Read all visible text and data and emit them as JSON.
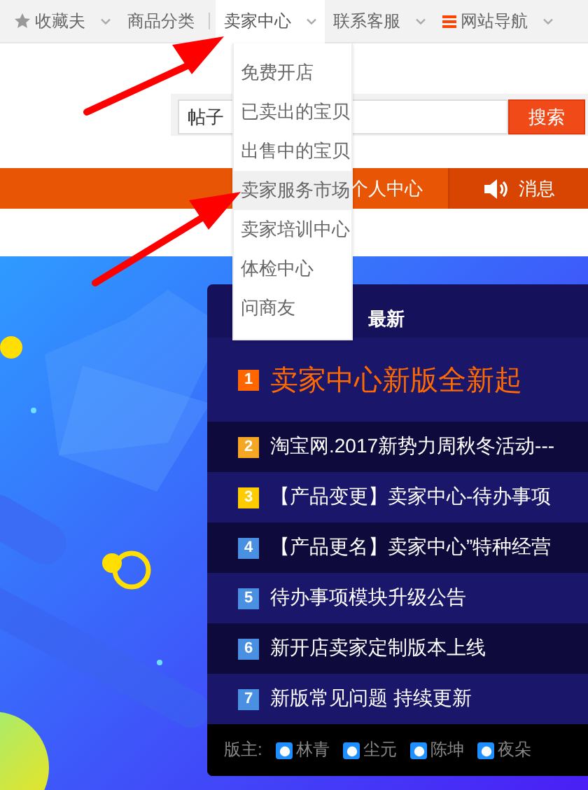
{
  "top_nav": [
    {
      "label": "收藏夫",
      "kind": "star",
      "has_caret": true,
      "selected": false
    },
    {
      "label": "商品分类",
      "kind": "plain",
      "has_caret": false,
      "selected": false
    },
    {
      "label": "卖家中心",
      "kind": "plain",
      "has_caret": true,
      "selected": true
    },
    {
      "label": "联系客服",
      "kind": "plain",
      "has_caret": true,
      "selected": false
    },
    {
      "label": "网站导航",
      "kind": "menu",
      "has_caret": true,
      "selected": false
    }
  ],
  "dropdown": [
    {
      "label": "免费开店",
      "highlighted": false
    },
    {
      "label": "已卖出的宝贝",
      "highlighted": false
    },
    {
      "label": "出售中的宝贝",
      "highlighted": false
    },
    {
      "label": "卖家服务市场",
      "highlighted": true
    },
    {
      "label": "卖家培训中心",
      "highlighted": false
    },
    {
      "label": "体检中心",
      "highlighted": false
    },
    {
      "label": "问商友",
      "highlighted": false
    }
  ],
  "search": {
    "placeholder": "帖子",
    "button": "搜索"
  },
  "orange_bar": [
    {
      "label": "个人中心",
      "kind": "plain"
    },
    {
      "label": "消息",
      "kind": "speaker"
    }
  ],
  "news_panel": {
    "title": "最新",
    "items": [
      {
        "number": "1",
        "text": "卖家中心新版全新起",
        "color": "#ff6600",
        "featured": true
      },
      {
        "number": "2",
        "text": "淘宝网.2017新势力周秋冬活动---",
        "color": "#f5a623",
        "featured": false
      },
      {
        "number": "3",
        "text": "【产品变更】卖家中心-待办事项",
        "color": "#ffcc00",
        "featured": false
      },
      {
        "number": "4",
        "text": "【产品更名】卖家中心”特种经营",
        "color": "#4a90e2",
        "featured": false
      },
      {
        "number": "5",
        "text": "待办事项模块升级公告",
        "color": "#4a90e2",
        "featured": false
      },
      {
        "number": "6",
        "text": "新开店卖家定制版本上线",
        "color": "#4a90e2",
        "featured": false
      },
      {
        "number": "7",
        "text": "新版常见问题 持续更新",
        "color": "#4a90e2",
        "featured": false
      }
    ],
    "moderators_label": "版主:",
    "moderators": [
      "林青",
      "尘元",
      "陈坤",
      "夜朵"
    ]
  }
}
